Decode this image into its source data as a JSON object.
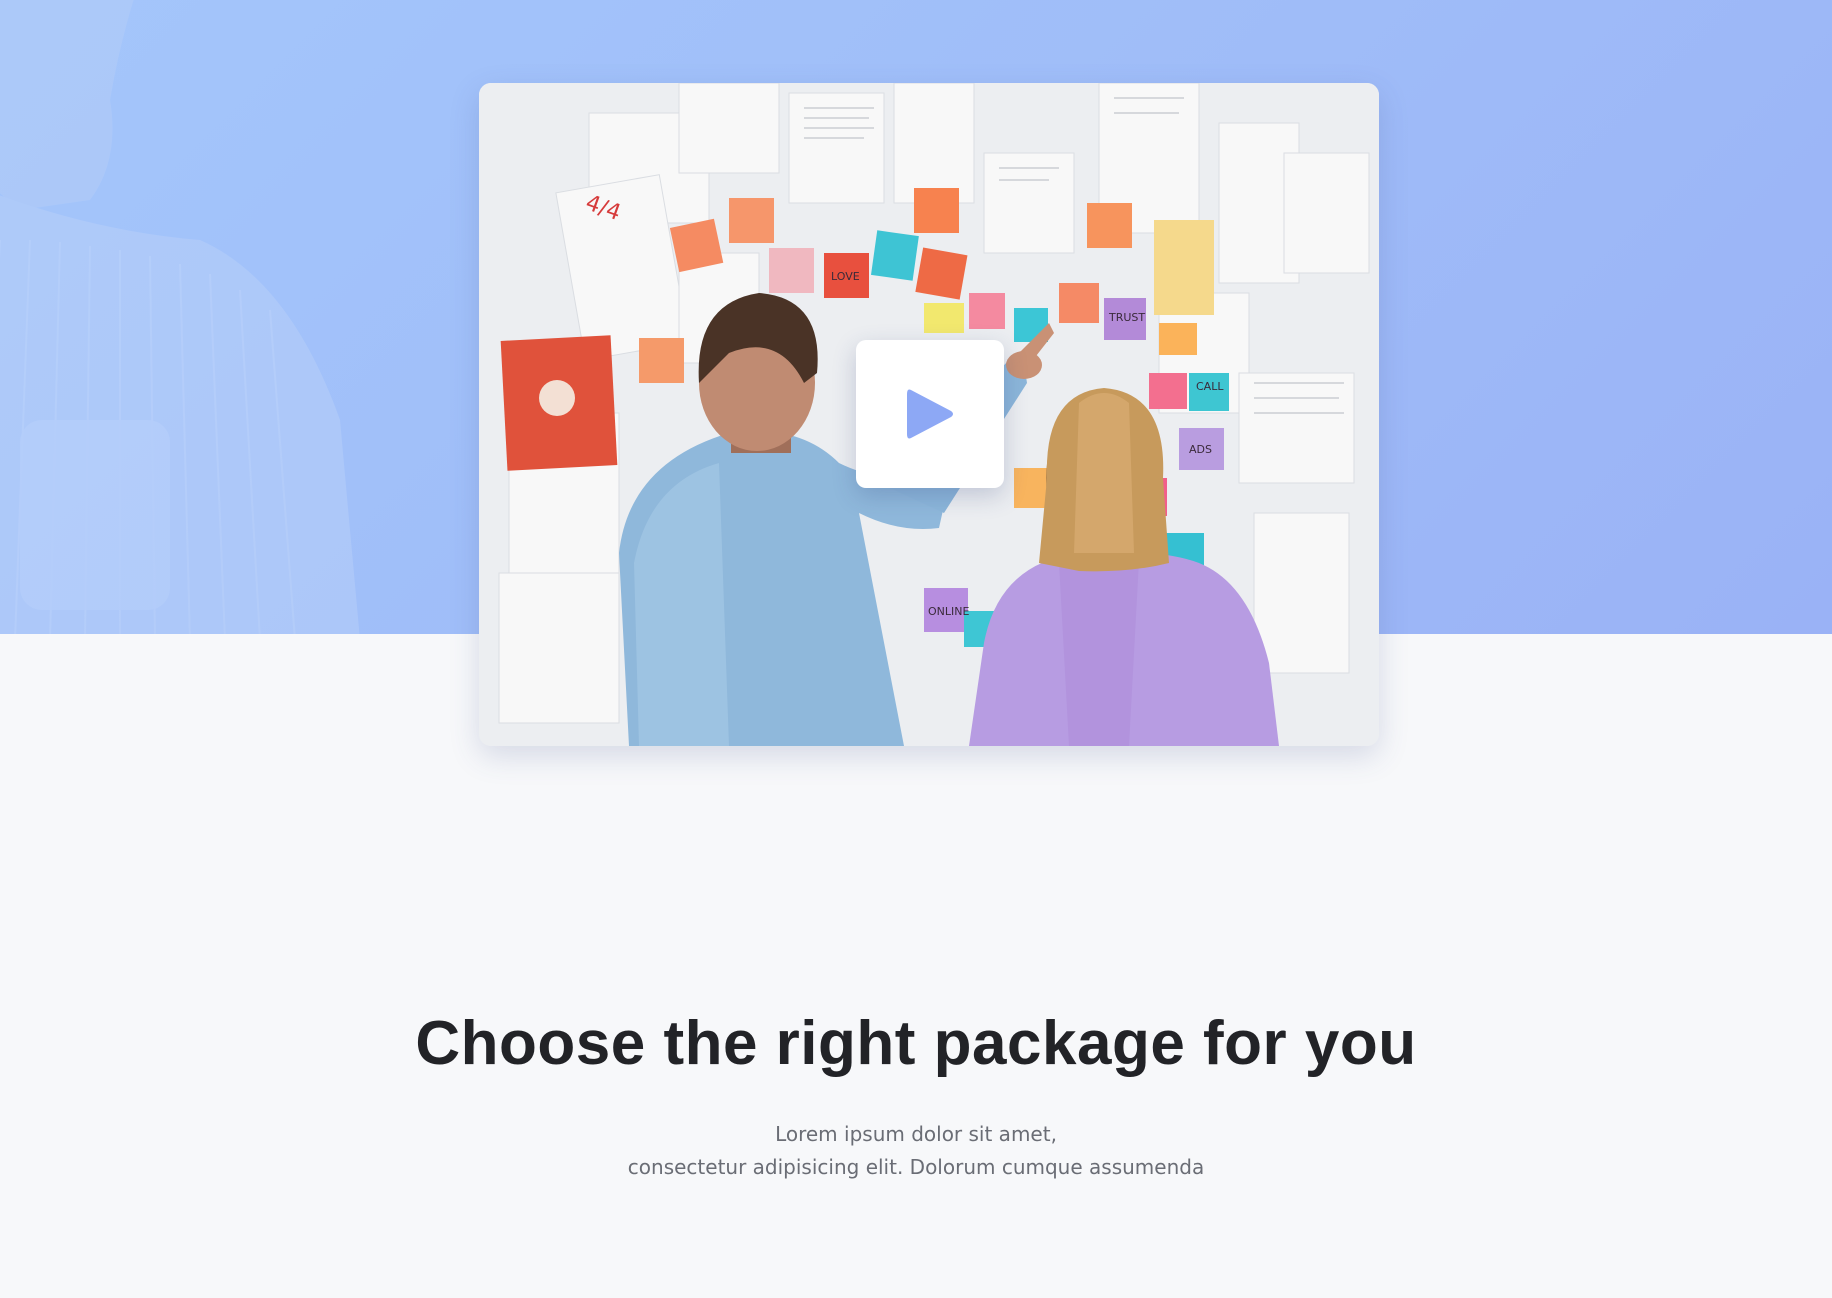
{
  "hero": {
    "background_colors": [
      "#a4c6fb",
      "#9ab2f6"
    ],
    "video": {
      "play_label": "Play video",
      "accent": "#8da8f5",
      "note_labels": [
        "4/4",
        "LOVE",
        "TRUST",
        "ADS",
        "ONLINE",
        "CALL"
      ]
    }
  },
  "pricing": {
    "title": "Choose the right package for you",
    "subtitle_line1": "Lorem ipsum dolor sit amet,",
    "subtitle_line2": "consectetur adipisicing elit. Dolorum cumque assumenda"
  },
  "icons": {
    "play": "play-icon"
  }
}
